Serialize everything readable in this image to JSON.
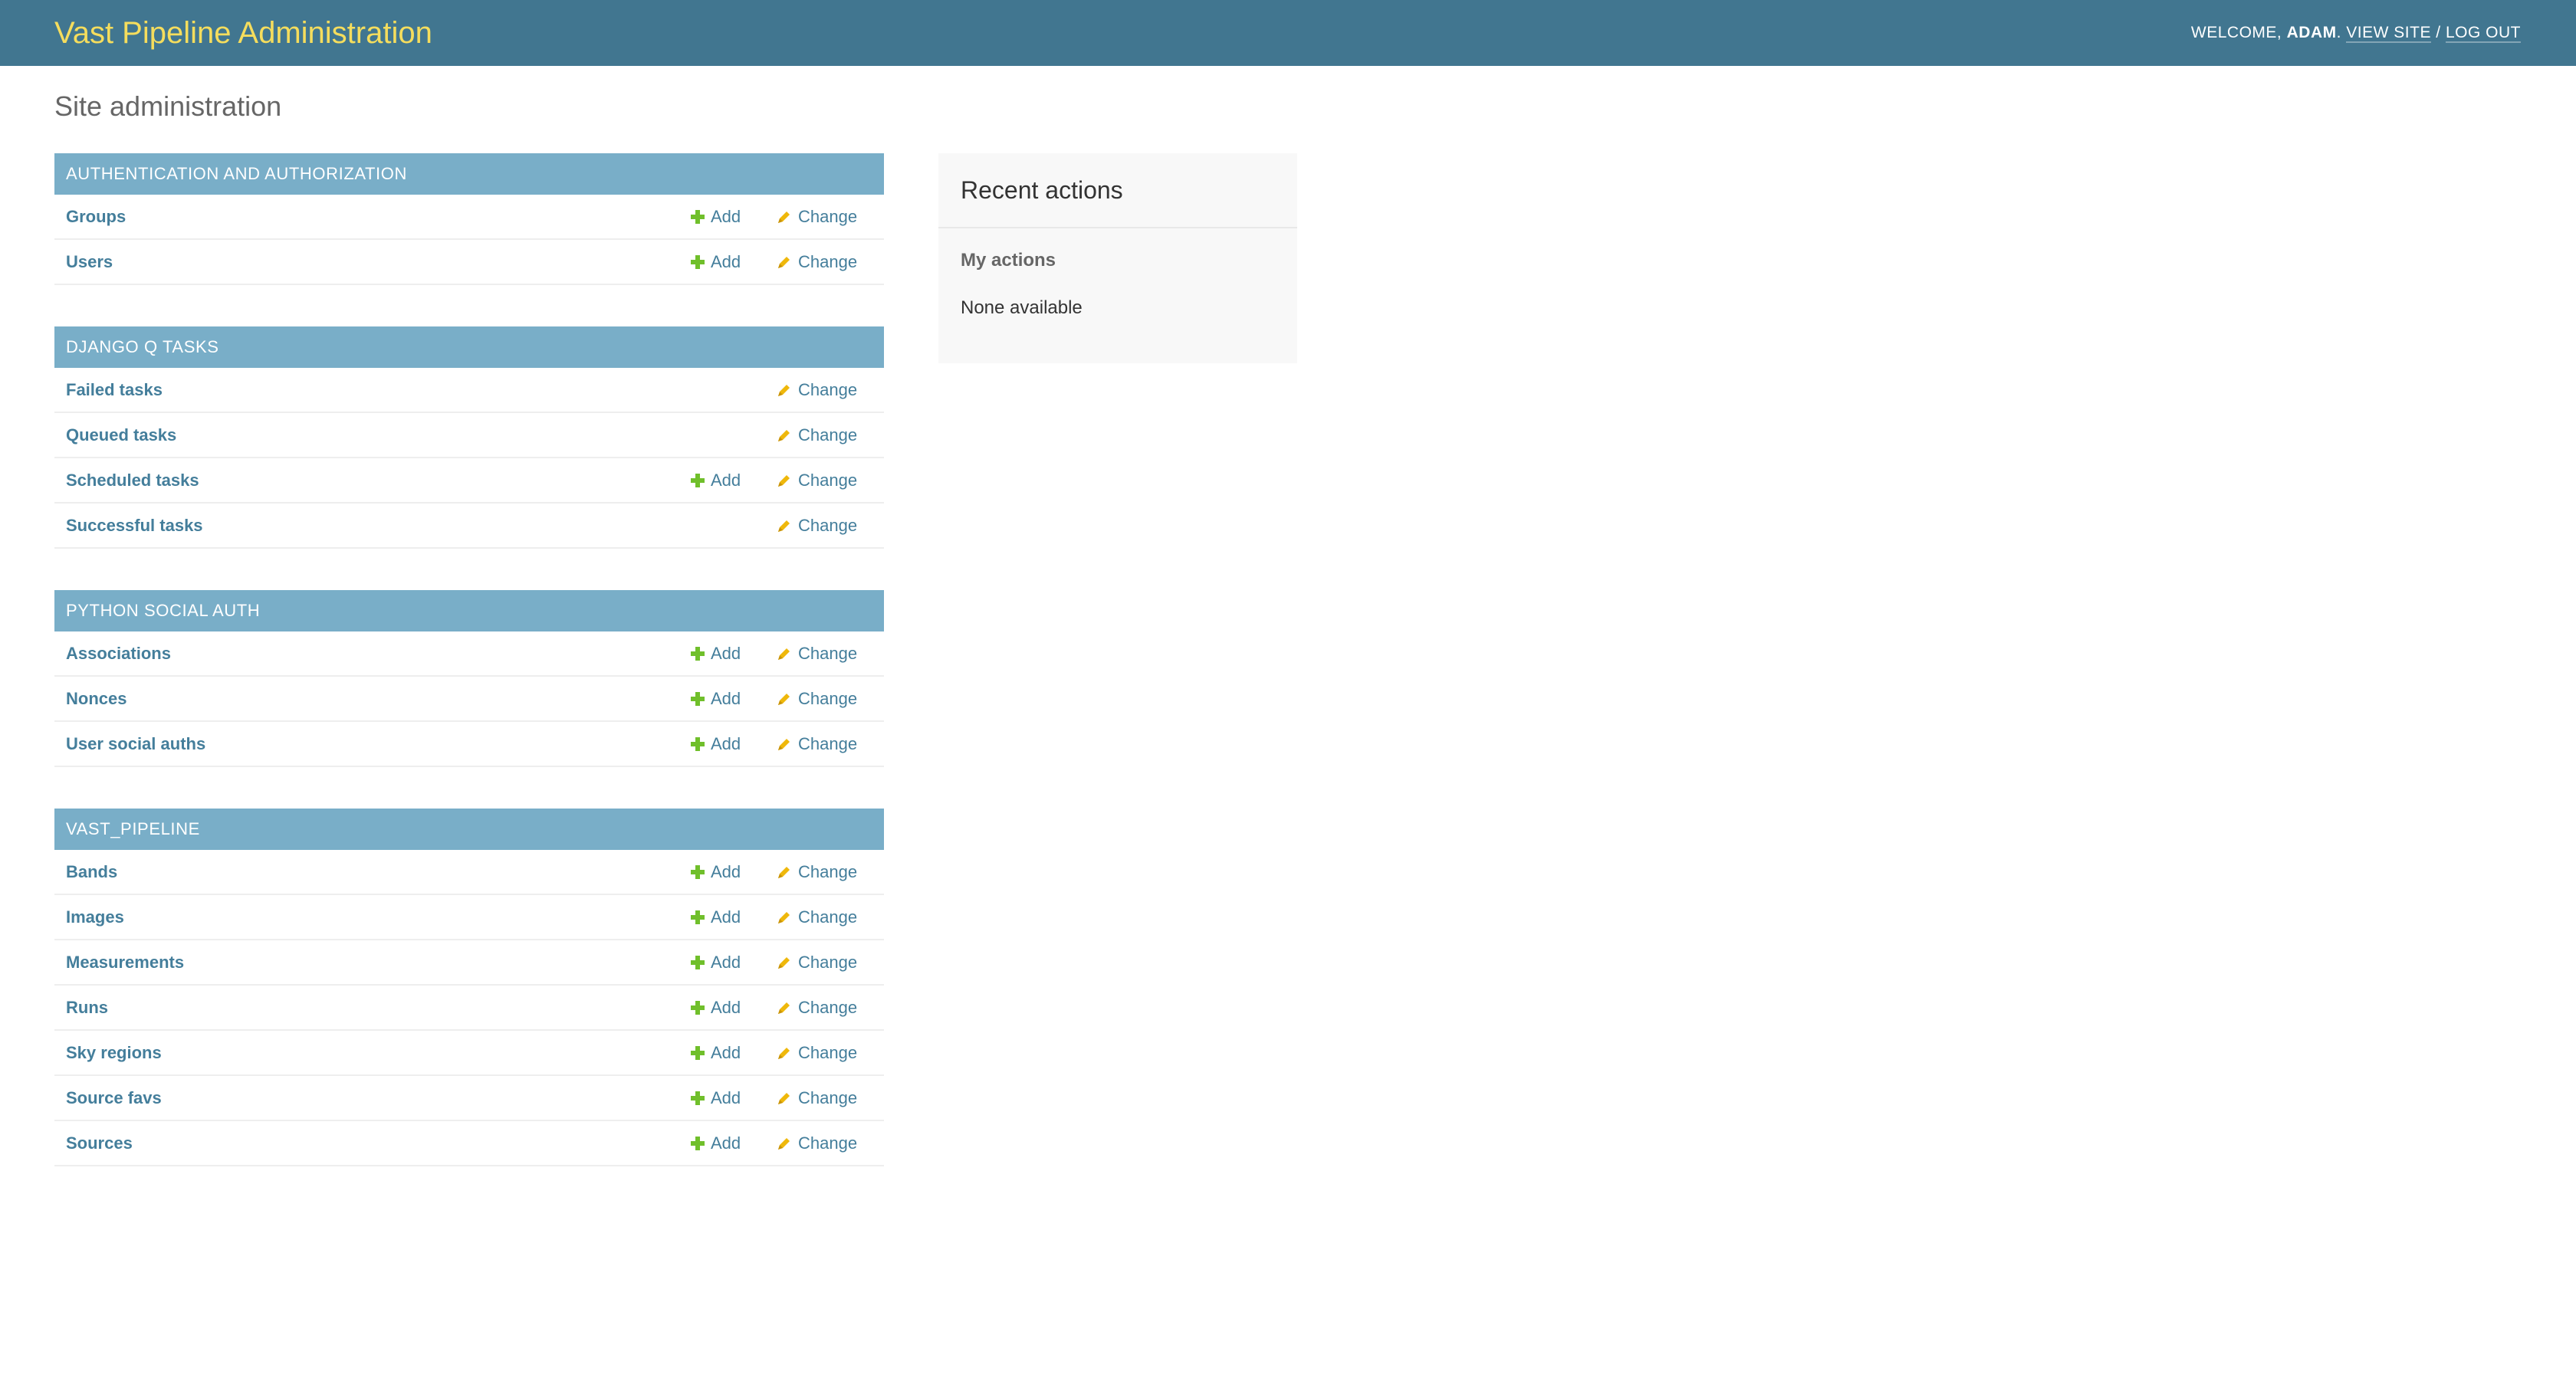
{
  "header": {
    "branding": "Vast Pipeline Administration",
    "welcome_prefix": "WELCOME, ",
    "username": "ADAM",
    "welcome_suffix": ". ",
    "view_site": "VIEW SITE",
    "separator": " / ",
    "log_out": "LOG OUT"
  },
  "page_title": "Site administration",
  "labels": {
    "add": "Add",
    "change": "Change"
  },
  "modules": [
    {
      "caption": "AUTHENTICATION AND AUTHORIZATION",
      "models": [
        {
          "name": "Groups",
          "add": true
        },
        {
          "name": "Users",
          "add": true
        }
      ]
    },
    {
      "caption": "DJANGO Q TASKS",
      "models": [
        {
          "name": "Failed tasks",
          "add": false
        },
        {
          "name": "Queued tasks",
          "add": false
        },
        {
          "name": "Scheduled tasks",
          "add": true
        },
        {
          "name": "Successful tasks",
          "add": false
        }
      ]
    },
    {
      "caption": "PYTHON SOCIAL AUTH",
      "models": [
        {
          "name": "Associations",
          "add": true
        },
        {
          "name": "Nonces",
          "add": true
        },
        {
          "name": "User social auths",
          "add": true
        }
      ]
    },
    {
      "caption": "VAST_PIPELINE",
      "models": [
        {
          "name": "Bands",
          "add": true
        },
        {
          "name": "Images",
          "add": true
        },
        {
          "name": "Measurements",
          "add": true
        },
        {
          "name": "Runs",
          "add": true
        },
        {
          "name": "Sky regions",
          "add": true
        },
        {
          "name": "Source favs",
          "add": true
        },
        {
          "name": "Sources",
          "add": true
        }
      ]
    }
  ],
  "recent_actions": {
    "title": "Recent actions",
    "my_actions": "My actions",
    "none_available": "None available"
  },
  "icons": {
    "add": "plus-icon",
    "change": "pencil-icon"
  },
  "colors": {
    "header_bg": "#417690",
    "branding": "#f5dd5d",
    "module_caption_bg": "#79aec8",
    "link": "#447e9b",
    "add_icon": "#70bf2b",
    "change_icon": "#efb80b"
  }
}
